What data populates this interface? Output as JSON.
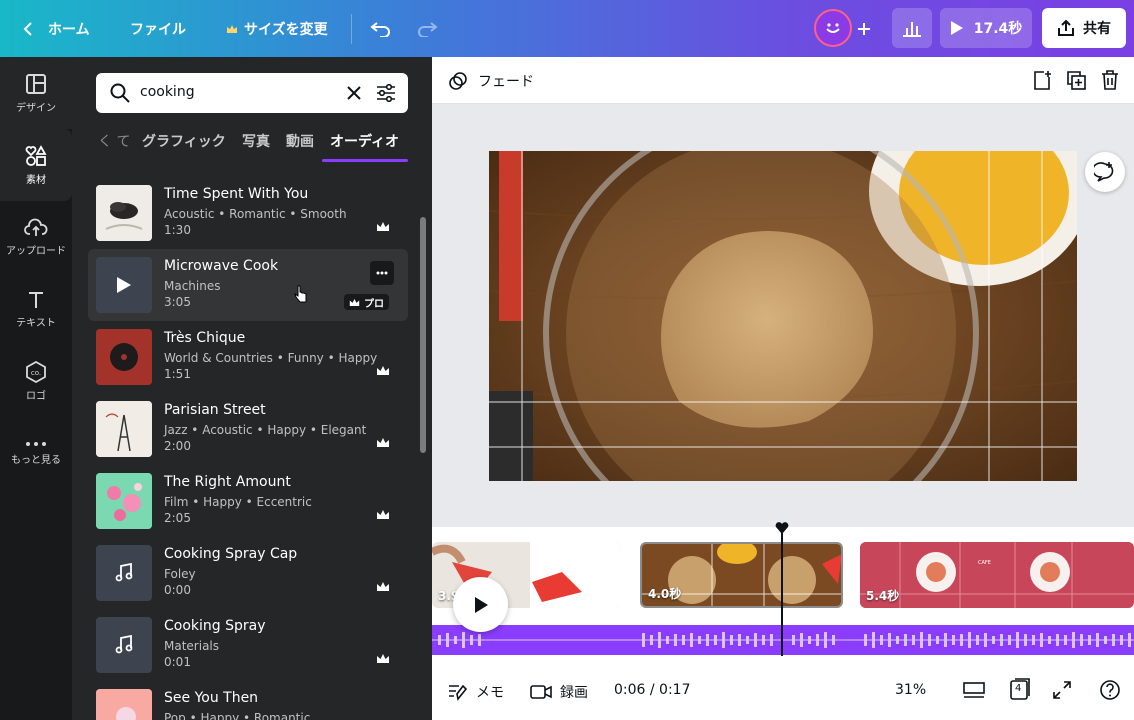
{
  "topbar": {
    "back_label": "ホーム",
    "file_label": "ファイル",
    "resize_label": "サイズを変更",
    "duration_label": "17.4秒",
    "share_label": "共有"
  },
  "rail": {
    "items": [
      {
        "label": "デザイン",
        "icon": "layout-icon"
      },
      {
        "label": "素材",
        "icon": "shapes-icon"
      },
      {
        "label": "アップロード",
        "icon": "cloud-upload-icon"
      },
      {
        "label": "テキスト",
        "icon": "text-icon"
      },
      {
        "label": "ロゴ",
        "icon": "logo-icon"
      },
      {
        "label": "もっと見る",
        "icon": "more-icon"
      }
    ]
  },
  "search": {
    "value": "cooking"
  },
  "tabs": {
    "prev": "く て",
    "items": [
      "グラフィック",
      "写真",
      "動画",
      "オーディオ"
    ]
  },
  "tracks": [
    {
      "title": "Time Spent With You",
      "meta": "Acoustic • Romantic • Smooth",
      "duration": "1:30"
    },
    {
      "title": "Microwave Cook",
      "meta": "Machines",
      "duration": "3:05",
      "badge": "プロ"
    },
    {
      "title": "Très Chique",
      "meta": "World & Countries • Funny • Happy",
      "duration": "1:51"
    },
    {
      "title": "Parisian Street",
      "meta": "Jazz • Acoustic • Happy • Elegant",
      "duration": "2:00"
    },
    {
      "title": "The Right Amount",
      "meta": "Film • Happy • Eccentric",
      "duration": "2:05"
    },
    {
      "title": "Cooking Spray Cap",
      "meta": "Foley",
      "duration": "0:00"
    },
    {
      "title": "Cooking Spray",
      "meta": "Materials",
      "duration": "0:01"
    },
    {
      "title": "See You Then",
      "meta": "Pop • Happy • Romantic",
      "duration": ""
    }
  ],
  "editor": {
    "transition_label": "フェード",
    "clips": [
      "3.9秒",
      "4.0秒",
      "5.4秒"
    ],
    "clip_inner_text": "CAFE",
    "footer": {
      "notes_label": "メモ",
      "record_label": "録画",
      "time": "0:06 / 0:17",
      "zoom": "31%",
      "page_count": "4"
    }
  },
  "colors": {
    "accent": "#8b3dff",
    "panel": "#252627",
    "rail": "#18191b"
  }
}
